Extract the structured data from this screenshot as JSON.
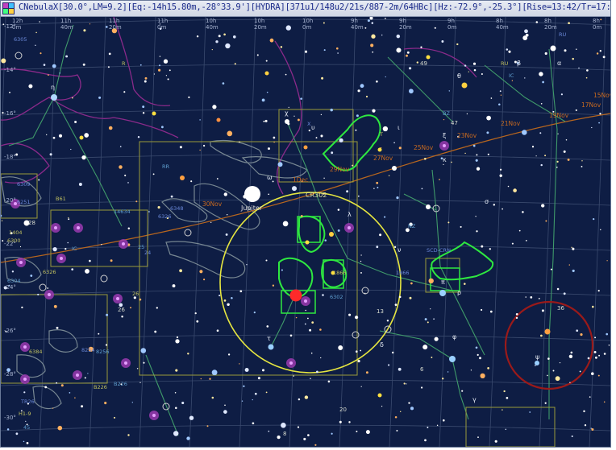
{
  "window": {
    "title": "CNebulaX[30.0°,LM=9.2][Eq:-14h15.80m,-28°33.9'][HYDRA][371u1/148u2/21s/887-2m/64HBc][Hz:-72.9°,-25.3°][Rise=13:42/Tr=17:58/Set=22"
  },
  "ra_labels": [
    {
      "h": "12h",
      "m": "0m"
    },
    {
      "h": "11h",
      "m": "40m"
    },
    {
      "h": "11h",
      "m": "20m"
    },
    {
      "h": "11h",
      "m": "0m"
    },
    {
      "h": "10h",
      "m": "40m"
    },
    {
      "h": "10h",
      "m": "20m"
    },
    {
      "h": "10h",
      "m": "0m"
    },
    {
      "h": "9h",
      "m": "40m"
    },
    {
      "h": "9h",
      "m": "20m"
    },
    {
      "h": "9h",
      "m": "0m"
    },
    {
      "h": "8h",
      "m": "40m"
    },
    {
      "h": "8h",
      "m": "20m"
    },
    {
      "h": "8h",
      "m": "0m"
    }
  ],
  "dec_labels": [
    "-12°",
    "-14°",
    "-16°",
    "-18°",
    "-20°",
    "-22°",
    "-24°",
    "-26°",
    "-28°",
    "-30°"
  ],
  "ecliptic_dates": [
    "21Nov",
    "25Nov",
    "29Nov",
    "1Dec",
    "30Nov",
    "27Nov",
    "23Nov",
    "19Nov",
    "17Nov",
    "15Nov"
  ],
  "planet": {
    "name": "Jupiter"
  },
  "cluster_label": "CR302",
  "object_labels": [
    "6305",
    "R",
    "RR",
    "RU",
    "RU",
    "IC",
    "X",
    "T",
    "14634",
    "6309",
    "B61",
    "IC",
    "6326",
    "6300",
    "NZ",
    "SCD-CRN",
    "1866",
    "6302",
    "1866",
    "B226",
    "25",
    "24",
    "26",
    "BZ",
    "TR26",
    "H1-9",
    "45",
    "6348",
    "6384",
    "8256",
    "8254",
    "6326",
    "6304",
    "6251",
    "1404",
    "B226"
  ],
  "star_labels": [
    "η",
    "θ",
    "ω",
    "τ",
    "π",
    "χ",
    "ψ",
    "σ",
    "κ",
    "ρ",
    "ι",
    "υ",
    "λ",
    "φ",
    "ν",
    "β",
    "ξ",
    "α",
    "γ",
    "δ"
  ],
  "number_labels": [
    "49",
    "47",
    "20",
    "13",
    "36",
    "28",
    "26",
    "6",
    "8"
  ],
  "colors": {
    "background": "#0e1d44",
    "grid": "#3a4a6e",
    "constellation_lines": "#3f9a6a",
    "boundary": "#8a2a8a",
    "fov_circle": "#e6e640",
    "telrad_circle": "#9a1a1a",
    "nebula_outline": "#2ee840",
    "milky_way": "#8a9aa0",
    "ecliptic": "#b8661e"
  }
}
